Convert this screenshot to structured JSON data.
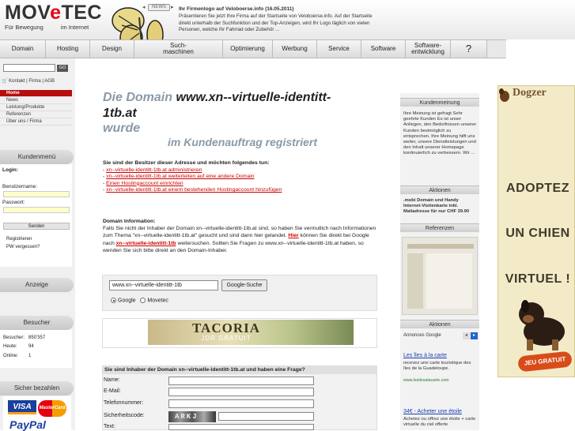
{
  "header": {
    "logo_text_pre": "MOV",
    "logo_text_e": "e",
    "logo_text_post": "TEC",
    "logo_sub_left": "Für Bewegung",
    "logo_sub_right": "im Internet",
    "news_tab": "NEWS",
    "news_title": "Ihr Firmenlogo auf Veloboerse.info (16.05.2011)",
    "news_text": "Präsentieren Sie jetzt Ihre Firma auf der Startseite von Veloboerse.info. Auf der Startseite direkt unterhalb der Suchfunktion und der Top-Anzeigen, wird Ihr Logo täglich von vielen Personen, welche Ihr Fahrrad oder Zubehör ..."
  },
  "nav": {
    "items": [
      "Domain",
      "Hosting",
      "Design",
      "Such-\nmaschinen",
      "Optimierung",
      "Werbung",
      "Service",
      "Software",
      "Software-\nentwicklung",
      "?"
    ]
  },
  "sidebar": {
    "go_label": "GO",
    "shop_row": "Kontakt | Firma | AGB",
    "menu": [
      "Home",
      "News",
      "Leistung/Produkte",
      "Referenzen",
      "Über uns / Firma"
    ],
    "kundenmenu_heading": "Kundenmenü",
    "login_label": "Login:",
    "username_label": "Benutzername:",
    "password_label": "Passwort:",
    "senden_label": "Senden",
    "register_link": "Registrieren",
    "forgot_link": "PW vergessen?",
    "anzeige_heading": "Anzeige",
    "besucher_heading": "Besucher",
    "besucher_rows": [
      {
        "label": "Besucher:",
        "value": "850'357"
      },
      {
        "label": "Heute:",
        "value": "94"
      },
      {
        "label": "Online:",
        "value": "1"
      }
    ],
    "pay_heading": "Sicher bezahlen",
    "pay_visa": "VISA",
    "pay_mastercard": "MasterCard",
    "pay_paypal": "PayPal"
  },
  "main": {
    "title_prefix": "Die Domain",
    "title_domain": "www.xn--virtuelle-identitt-1tb.at",
    "title_suffix": "wurde",
    "title_line3": "im Kundenauftrag registriert",
    "owner_heading": "Sie sind der Besitzer dieser Adresse und möchten folgendes tun:",
    "owner_links": [
      "xn--virtuelle-identitt-1tb.at administrieren",
      "xn--virtuelle-identitt-1tb.at weiterleiten auf eine andere Domain",
      "Einen Hostingaccount einrichten",
      "xn--virtuelle-identitt-1tb.at einem bestehenden Hostingaccount hinzufügen"
    ],
    "info_heading": "Domain Information:",
    "info_text_1": "Falls Sie nicht der Inhaber der Domain xn--virtuelle-identitt-1tb.at sind, so haben Sie vermutlich nach Informationen zum Thema \"xn--virtuelle-identitt-1tb.at\" gesucht und sind dann hier gelandet.",
    "info_hier": "Hier",
    "info_text_2": "können Sie direkt bei Google nach",
    "info_domain_link": "xn--virtuelle-identitt-1tb",
    "info_text_3": "weitersuchen. Sollten Sie Fragen zu www.xn--virtuelle-identitt-1tb.at haben, so wenden Sie sich bitte direkt an den Domain-Inhaber.",
    "google_value": "www.xn--virtuelle-identitt-1tb",
    "google_button": "Google-Suche",
    "radio_google": "Google",
    "radio_movetec": "Movetec",
    "banner_title": "TACORIA",
    "banner_sub": "JDR GRATUIT",
    "form_heading": "Sie sind Inhaber der Domain xn--virtuelle-identitt-1tb.at und haben eine Frage?",
    "form_fields": [
      "Name:",
      "E-Mail:",
      "Telefonnummer:",
      "Sicherheitscode:",
      "Text:"
    ],
    "captcha_text": "ARKJ"
  },
  "right": {
    "kundenmeinung_heading": "Kundenmeinung",
    "kundenmeinung_text": "Ihre Meinung ist gefragt Sehr geehrte Kunden Es ist unser Anliegen, den Bedürfnissen unserer Kunden bestmöglich zu entsprechen. Ihre Meinung hilft uns weiter, unsere Dienstleistungen und den Inhalt unserer Homepage kontinuierlich zu verbessern. Wir ...",
    "aktionen_heading": "Aktionen",
    "aktionen_text": ".mobi Domain und Handy Internet-Visitenkarte inkl. Mailadresse für nur CHF 39.90",
    "referenzen_heading": "Referenzen",
    "aktionen2_heading": "Aktionen",
    "annonces": "Annonces Google",
    "ad1_title": "Les îles à la carte",
    "ad1_text": "recevez une carte touristique des îles de la Guadeloupe.",
    "ad1_url": "www.lesilesalacarte.com",
    "ad2_title": "34€ - Acheter une étoile",
    "ad2_text": "Achetez ou offrez une étoile + carte virtuelle du ciel offerte"
  },
  "dogzer": {
    "title": "Dogzer",
    "line1": "ADOPTEZ",
    "line2": "UN CHIEN",
    "line3": "VIRTUEL !",
    "button": "JEU GRATUIT"
  },
  "colors": {
    "accent_red": "#b70d0d",
    "link_red": "#cc0000",
    "title_grey": "#8a9aa8"
  }
}
